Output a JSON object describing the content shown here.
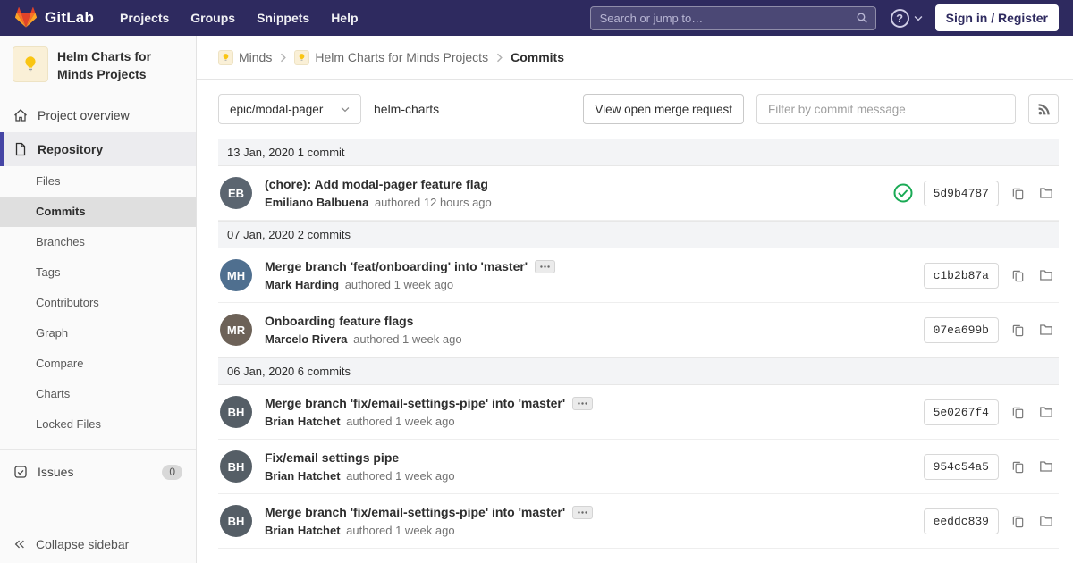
{
  "navbar": {
    "brand": "GitLab",
    "menu": [
      "Projects",
      "Groups",
      "Snippets",
      "Help"
    ],
    "search_placeholder": "Search or jump to…",
    "help_glyph": "?",
    "sign_in_label": "Sign in / Register"
  },
  "sidebar": {
    "project_title": "Helm Charts for Minds Projects",
    "nav": {
      "project_overview": "Project overview",
      "repository": "Repository",
      "issues": "Issues",
      "issues_count": "0",
      "collapse": "Collapse sidebar"
    },
    "repo_subitems": [
      {
        "label": "Files",
        "active": false
      },
      {
        "label": "Commits",
        "active": true
      },
      {
        "label": "Branches",
        "active": false
      },
      {
        "label": "Tags",
        "active": false
      },
      {
        "label": "Contributors",
        "active": false
      },
      {
        "label": "Graph",
        "active": false
      },
      {
        "label": "Compare",
        "active": false
      },
      {
        "label": "Charts",
        "active": false
      },
      {
        "label": "Locked Files",
        "active": false
      }
    ]
  },
  "breadcrumb": {
    "group": "Minds",
    "project": "Helm Charts for Minds Projects",
    "current": "Commits"
  },
  "controls": {
    "branch": "epic/modal-pager",
    "repo_name": "helm-charts",
    "merge_request_label": "View open merge request",
    "filter_placeholder": "Filter by commit message"
  },
  "commits": {
    "groups": [
      {
        "header": "13 Jan, 2020 1 commit",
        "items": [
          {
            "title": "(chore): Add modal-pager feature flag",
            "author": "Emiliano Balbuena",
            "authored": "authored 12 hours ago",
            "sha": "5d9b4787",
            "initials": "EB",
            "avatar_color": "#5b6570",
            "has_expander": false,
            "has_pipeline": true
          }
        ]
      },
      {
        "header": "07 Jan, 2020 2 commits",
        "items": [
          {
            "title": "Merge branch 'feat/onboarding' into 'master'",
            "author": "Mark Harding",
            "authored": "authored 1 week ago",
            "sha": "c1b2b87a",
            "initials": "MH",
            "avatar_color": "#4f6f8f",
            "has_expander": true,
            "has_pipeline": false
          },
          {
            "title": "Onboarding feature flags",
            "author": "Marcelo Rivera",
            "authored": "authored 1 week ago",
            "sha": "07ea699b",
            "initials": "MR",
            "avatar_color": "#6d6258",
            "has_expander": false,
            "has_pipeline": false
          }
        ]
      },
      {
        "header": "06 Jan, 2020 6 commits",
        "items": [
          {
            "title": "Merge branch 'fix/email-settings-pipe' into 'master'",
            "author": "Brian Hatchet",
            "authored": "authored 1 week ago",
            "sha": "5e0267f4",
            "initials": "BH",
            "avatar_color": "#555e66",
            "has_expander": true,
            "has_pipeline": false
          },
          {
            "title": "Fix/email settings pipe",
            "author": "Brian Hatchet",
            "authored": "authored 1 week ago",
            "sha": "954c54a5",
            "initials": "BH",
            "avatar_color": "#555e66",
            "has_expander": false,
            "has_pipeline": false
          },
          {
            "title": "Merge branch 'fix/email-settings-pipe' into 'master'",
            "author": "Brian Hatchet",
            "authored": "authored 1 week ago",
            "sha": "eeddc839",
            "initials": "BH",
            "avatar_color": "#555e66",
            "has_expander": true,
            "has_pipeline": false
          }
        ]
      }
    ]
  },
  "colors": {
    "navbar_bg": "#2e2a5f",
    "accent_purple": "#4545a5",
    "success_green": "#1aaa55",
    "tanuki_red": "#e24329",
    "tanuki_orange": "#fc6d26",
    "tanuki_yellow": "#fca326"
  }
}
